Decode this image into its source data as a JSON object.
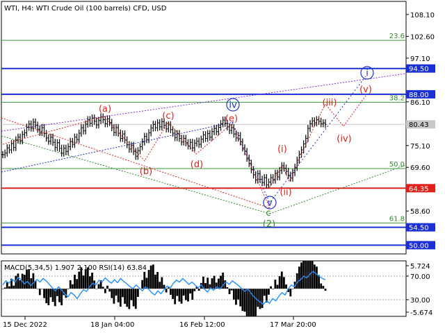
{
  "chart_data": [
    {
      "type": "line",
      "title": "WTI, H4:  WTI Crude Oil (100 barrels) CFD, USD",
      "x_ticks": [
        "15 Dec 2022",
        "18 Jan 04:00",
        "16 Feb 12:00",
        "17 Mar 20:00"
      ],
      "y_ticks": [
        108.1,
        102.6,
        97.1,
        86.1,
        75.1,
        69.6,
        58.6
      ],
      "ylim": [
        47.8,
        111.4
      ],
      "current_price": 80.43,
      "price_series": [
        72.8,
        73.2,
        74.5,
        74.0,
        75.6,
        74.6,
        76.5,
        77.2,
        76.3,
        77.9,
        78.3,
        79.7,
        80.5,
        79.5,
        81.0,
        80.2,
        79.2,
        78.4,
        79.6,
        78.1,
        77.0,
        76.2,
        77.2,
        75.9,
        74.6,
        75.8,
        74.4,
        73.2,
        74.4,
        73.6,
        74.8,
        76.1,
        75.4,
        77.2,
        76.6,
        78.2,
        79.6,
        78.8,
        80.5,
        81.6,
        80.7,
        82.0,
        81.2,
        80.3,
        81.4,
        82.3,
        81.6,
        80.6,
        81.8,
        80.9,
        79.6,
        78.4,
        79.6,
        78.2,
        76.9,
        78.0,
        76.5,
        75.3,
        74.2,
        75.1,
        73.6,
        72.4,
        73.8,
        74.8,
        76.0,
        77.4,
        76.6,
        78.3,
        79.5,
        80.4,
        79.6,
        80.8,
        79.8,
        81.1,
        80.2,
        79.3,
        80.3,
        79.1,
        78.2,
        77.1,
        78.1,
        76.9,
        76.0,
        76.9,
        75.8,
        75.0,
        75.9,
        74.5,
        75.7,
        76.2,
        75.4,
        76.7,
        77.8,
        76.9,
        78.1,
        77.2,
        78.6,
        79.4,
        78.6,
        79.7,
        80.6,
        81.5,
        80.7,
        79.8,
        78.9,
        79.6,
        78.0,
        77.0,
        77.6,
        76.0,
        74.5,
        73.6,
        71.9,
        70.6,
        69.0,
        67.7,
        66.4,
        68.0,
        66.6,
        65.8,
        67.0,
        65.2,
        65.9,
        67.0,
        66.4,
        68.1,
        67.2,
        68.8,
        70.0,
        69.4,
        68.6,
        67.6,
        66.9,
        68.3,
        69.6,
        71.4,
        72.9,
        74.0,
        75.5,
        76.9,
        79.4,
        80.6,
        81.3,
        80.8,
        81.6,
        81.2,
        80.6,
        80.8,
        80.43
      ],
      "levels": [
        {
          "name": "blue",
          "value": 94.5,
          "color": "#1a2fd6"
        },
        {
          "name": "blue",
          "value": 88.0,
          "color": "#1a2fd6"
        },
        {
          "name": "red",
          "value": 64.35,
          "color": "#e0201a"
        },
        {
          "name": "blue",
          "value": 54.5,
          "color": "#1a2fd6"
        },
        {
          "name": "blue",
          "value": 50.0,
          "color": "#1a2fd6"
        }
      ],
      "fib_levels": [
        {
          "label": "23.6",
          "value": 101.6
        },
        {
          "label": "38.2",
          "value": 86.0
        },
        {
          "label": "50.0",
          "value": 69.3
        },
        {
          "label": "61.8",
          "value": 55.6
        }
      ],
      "wave_labels": {
        "red": [
          "(a)",
          "(b)",
          "(c)",
          "(d)",
          "(e)",
          "(i)",
          "(ii)",
          "(iii)",
          "(iv)",
          "(v)"
        ],
        "green": [
          "c",
          "(2)"
        ],
        "blue": [
          "iv",
          "v",
          "i"
        ]
      }
    },
    {
      "type": "line",
      "title": "MACD(5,34,5) 1.907 2.100 RSI(14) 63.84",
      "y_ticks": [
        5.724,
        70.0,
        30.0,
        -5.674
      ],
      "rsi_values": [
        55,
        62,
        58,
        65,
        60,
        68,
        63,
        57,
        61,
        54,
        59,
        64,
        60,
        66,
        62,
        56,
        50,
        45,
        52,
        46,
        40,
        35,
        42,
        38,
        32,
        40,
        47,
        44,
        52,
        58,
        55,
        63,
        60,
        67,
        62,
        58,
        64,
        59,
        66,
        61,
        57,
        52,
        49,
        55,
        50,
        45,
        52,
        48,
        42,
        38,
        45,
        40,
        47,
        53,
        50,
        58,
        63,
        60,
        66,
        61,
        56,
        60,
        55,
        50,
        55,
        48,
        43,
        50,
        46,
        52,
        48,
        55,
        60,
        56,
        62,
        58,
        54,
        49,
        44,
        48,
        41,
        35,
        30,
        26,
        22,
        28,
        24,
        32,
        28,
        36,
        42,
        38,
        48,
        55,
        52,
        60,
        64,
        70,
        67,
        73,
        78,
        74,
        70,
        66,
        64
      ]
    }
  ]
}
